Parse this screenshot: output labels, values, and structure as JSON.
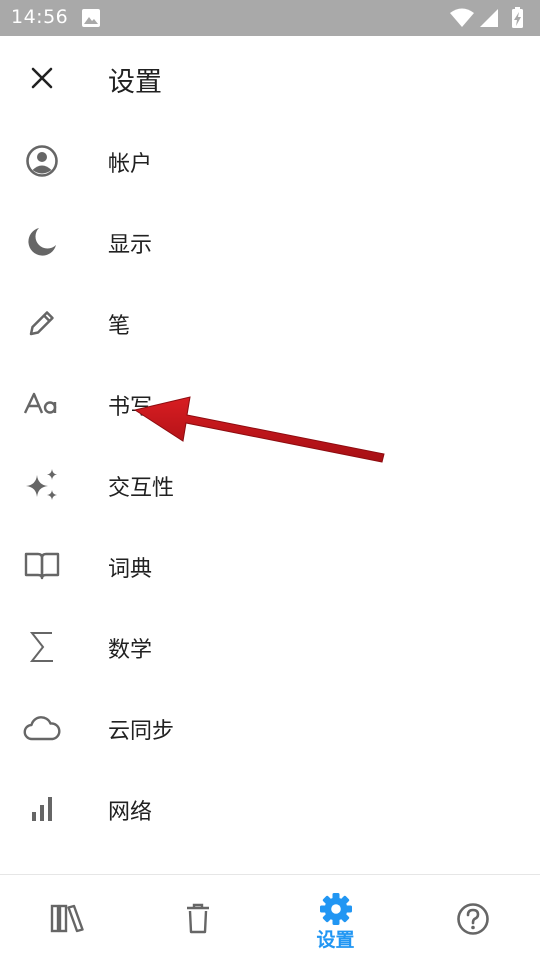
{
  "status_bar": {
    "time": "14:56",
    "icons": [
      "image-icon",
      "wifi-icon",
      "signal-icon",
      "battery-charging-icon"
    ]
  },
  "header": {
    "title": "设置",
    "close_icon": "close-icon"
  },
  "menu": {
    "items": [
      {
        "label": "帐户",
        "icon": "account-circle-icon"
      },
      {
        "label": "显示",
        "icon": "moon-icon"
      },
      {
        "label": "笔",
        "icon": "pencil-icon"
      },
      {
        "label": "书写",
        "icon": "font-aa-icon"
      },
      {
        "label": "交互性",
        "icon": "sparkle-icon"
      },
      {
        "label": "词典",
        "icon": "book-open-icon"
      },
      {
        "label": "数学",
        "icon": "sigma-icon"
      },
      {
        "label": "云同步",
        "icon": "cloud-icon"
      },
      {
        "label": "网络",
        "icon": "bar-chart-icon"
      }
    ]
  },
  "bottom_nav": {
    "items": [
      {
        "label": "",
        "icon": "library-icon",
        "active": false
      },
      {
        "label": "",
        "icon": "trash-icon",
        "active": false
      },
      {
        "label": "设置",
        "icon": "gear-icon",
        "active": true
      },
      {
        "label": "",
        "icon": "help-icon",
        "active": false
      }
    ]
  },
  "colors": {
    "status_bar": "#a9a9a9",
    "accent": "#2196f3",
    "icon_gray": "#666666",
    "arrow": "#c4161c"
  },
  "annotation": {
    "type": "arrow",
    "target": "menu item 书写"
  }
}
